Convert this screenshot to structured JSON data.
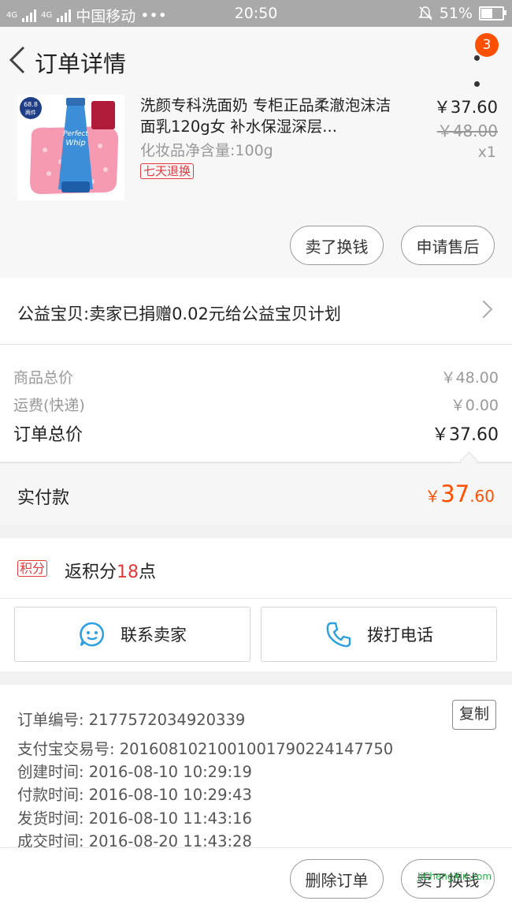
{
  "status_bar": {
    "network_a": "4G",
    "network_b": "4G",
    "carrier": "中国移动",
    "dots": "•••",
    "time": "20:50",
    "battery": "51%"
  },
  "header": {
    "title": "订单详情",
    "notification_count": "3"
  },
  "product": {
    "name": "洗颜专科洗面奶 专柜正品柔澈泡沫洁面乳120g女 补水保湿深层...",
    "spec": "化妆品净含量:100g",
    "return_tag": "七天退换",
    "price": "￥37.60",
    "original_price": "￥48.00",
    "quantity": "x1",
    "thumb_badge_top": "68.8",
    "thumb_badge_bottom": "两件",
    "thumb_brand_line1": "Perfect",
    "thumb_brand_line2": "Whip"
  },
  "product_actions": {
    "resell": "卖了换钱",
    "after_sales": "申请售后"
  },
  "charity": {
    "text": "公益宝贝:卖家已捐赠0.02元给公益宝贝计划"
  },
  "totals": {
    "goods_label": "商品总价",
    "goods_value": "￥48.00",
    "shipping_label": "运费(快递)",
    "shipping_value": "￥0.00",
    "order_label": "订单总价",
    "order_value": "￥37.60"
  },
  "paid": {
    "label": "实付款",
    "currency": "￥",
    "integer": "37",
    "decimal": ".60"
  },
  "points": {
    "tag": "积分",
    "prefix": "返积分",
    "amount": "18",
    "suffix": "点"
  },
  "contact": {
    "seller": "联系卖家",
    "call": "拨打电话"
  },
  "order_info": {
    "order_no": "订单编号: 2177572034920339",
    "copy_label": "复制",
    "alipay_no": "支付宝交易号: 2016081021001001790224147750",
    "created": "创建时间: 2016-08-10 10:29:19",
    "paid": "付款时间: 2016-08-10 10:29:43",
    "shipped": "发货时间: 2016-08-10 11:43:16",
    "completed": "成交时间: 2016-08-20 11:43:28"
  },
  "bottom_actions": {
    "delete": "删除订单",
    "resell": "卖了换钱"
  },
  "watermark": "JiChengXin.com",
  "colors": {
    "accent_orange": "#ff5000",
    "tag_red": "#e4393c",
    "icon_blue": "#2aa0e0"
  }
}
